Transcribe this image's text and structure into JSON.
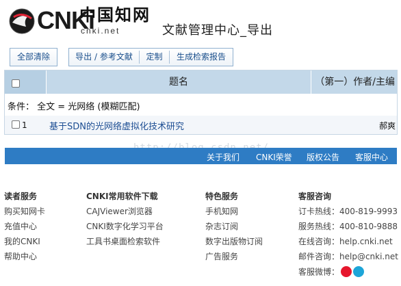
{
  "header": {
    "logo_cnki": "CNKi",
    "logo_zh": "中国知网",
    "logo_url": "cnki.net",
    "page_title": "文献管理中心_导出"
  },
  "toolbar": {
    "clear_all": "全部清除",
    "export_refs": "导出 / 参考文献",
    "customize": "定制",
    "generate_report": "生成检索报告"
  },
  "table": {
    "headers": {
      "title": "题名",
      "author": "（第一）作者/主编"
    },
    "condition": "条件： 全文 = 光网络 (模糊匹配)",
    "rows": [
      {
        "num": "1",
        "title": "基于SDN的光网络虚拟化技术研究",
        "author": "郝爽"
      }
    ]
  },
  "watermark": "http://blog.csdn.net/",
  "footer_bar": {
    "links": [
      "关于我们",
      "CNKI荣誉",
      "版权公告",
      "客服中心"
    ]
  },
  "columns": [
    {
      "title": "读者服务",
      "items": [
        "购买知网卡",
        "充值中心",
        "我的CNKI",
        "帮助中心"
      ]
    },
    {
      "title": "CNKI常用软件下载",
      "items": [
        "CAJViewer浏览器",
        "CNKI数字化学习平台",
        "工具书桌面检索软件"
      ]
    },
    {
      "title": "特色服务",
      "items": [
        "手机知网",
        "杂志订阅",
        "数字出版物订阅",
        "广告服务"
      ]
    },
    {
      "title": "客服咨询",
      "items": [
        "订卡热线：400-819-9993",
        "服务热线：400-810-9888",
        "在线咨询：help.cnki.net",
        "邮件咨询：help@cnki.net",
        "客服微博："
      ]
    }
  ],
  "icons": {
    "weibo": "weibo-icon",
    "tencent_weibo": "tencent-weibo-icon",
    "globe": "cnki-globe-icon"
  },
  "colors": {
    "footer_bar": "#2e7cc4",
    "table_header": "#c3d8e9",
    "link": "#1d4e93"
  }
}
